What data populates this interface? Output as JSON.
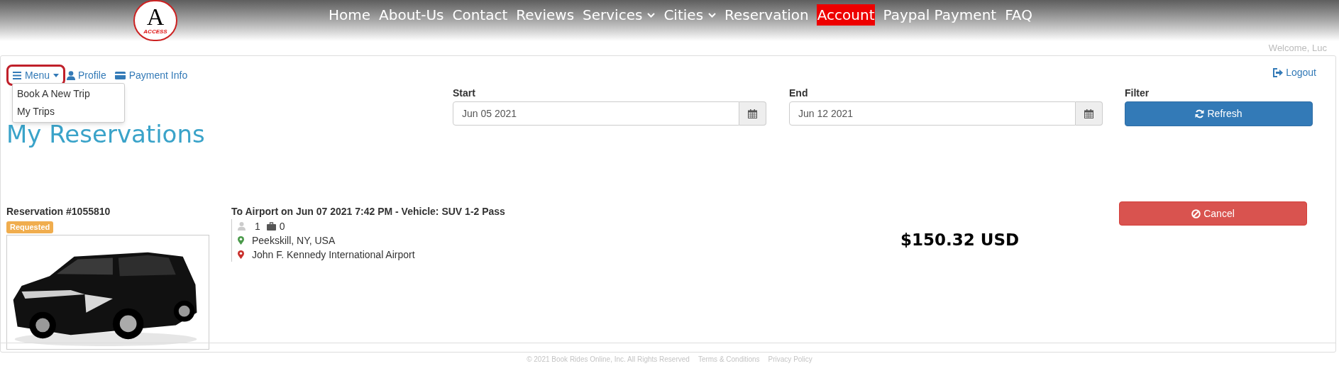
{
  "logo": {
    "letter": "A",
    "text": "ACCESS"
  },
  "nav": [
    {
      "label": "Home",
      "selected": false,
      "dropdown": false
    },
    {
      "label": "About-Us",
      "selected": false,
      "dropdown": false
    },
    {
      "label": "Contact",
      "selected": false,
      "dropdown": false
    },
    {
      "label": "Reviews",
      "selected": false,
      "dropdown": false
    },
    {
      "label": "Services",
      "selected": false,
      "dropdown": true
    },
    {
      "label": "Cities",
      "selected": false,
      "dropdown": true
    },
    {
      "label": "Reservation",
      "selected": false,
      "dropdown": false
    },
    {
      "label": "Account",
      "selected": true,
      "dropdown": false
    },
    {
      "label": "Paypal Payment",
      "selected": false,
      "dropdown": false
    },
    {
      "label": "FAQ",
      "selected": false,
      "dropdown": false
    }
  ],
  "welcome": "Welcome, Luc",
  "toolbar": {
    "menu": {
      "label": "Menu",
      "highlighted": true,
      "expanded": true,
      "items": [
        "Book A New Trip",
        "My Trips"
      ]
    },
    "profile": "Profile",
    "payment_info": "Payment Info",
    "logout": "Logout"
  },
  "title": "My Reservations",
  "filters": {
    "start": {
      "label": "Start",
      "value": "Jun 05 2021"
    },
    "end": {
      "label": "End",
      "value": "Jun 12 2021"
    },
    "filter": {
      "label": "Filter",
      "button": "Refresh"
    }
  },
  "reservations": [
    {
      "number": "Reservation #1055810",
      "status": "Requested",
      "trip": "To Airport on Jun 07 2021 7:42 PM - Vehicle: SUV 1-2 Pass",
      "passengers": "1",
      "luggage": "0",
      "locations": [
        {
          "name": "Peekskill, NY, USA",
          "color": "#4a9a4a"
        },
        {
          "name": "John F. Kennedy International Airport",
          "color": "#c9302c"
        }
      ],
      "price": "$150.32 USD",
      "action": "Cancel"
    }
  ],
  "footer": {
    "copyright": "© 2021 Book Rides Online, Inc. All Rights Reserved",
    "links": [
      "Terms & Conditions",
      "Privacy Policy"
    ]
  }
}
